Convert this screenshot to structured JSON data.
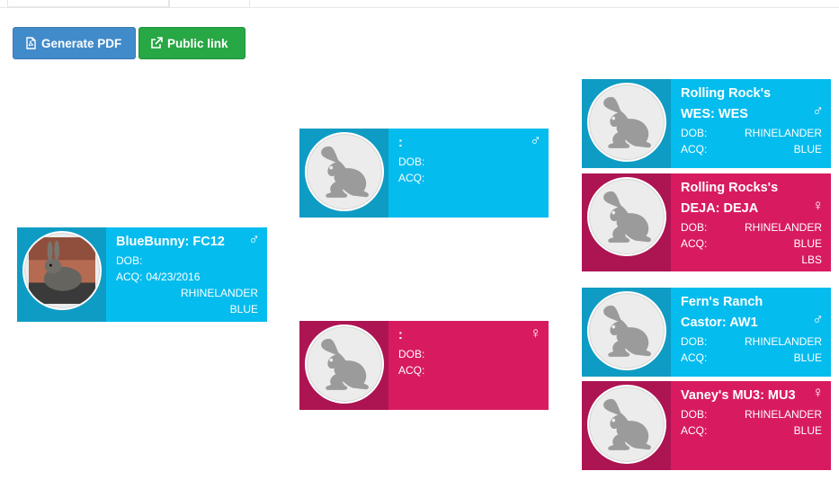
{
  "toolbar": {
    "generate_pdf_label": "Generate PDF",
    "public_link_label": "Public link"
  },
  "colors": {
    "male_card": "#04bcee",
    "female_card": "#d81b60",
    "pdf_button": "#428bca",
    "link_button": "#28a745"
  },
  "labels": {
    "dob": "DOB:",
    "acq": "ACQ:"
  },
  "subject": {
    "name": "BlueBunny: FC12",
    "sex_symbol": "♂",
    "dob": "",
    "acq": "04/23/2016",
    "breed": "RHINELANDER",
    "color": "BLUE",
    "photo": "rabbit-photo"
  },
  "sire": {
    "name": ":",
    "sex_symbol": "♂",
    "dob": "",
    "acq": "",
    "photo": "rabbit-silhouette-icon"
  },
  "dam": {
    "name": ":",
    "sex_symbol": "♀",
    "dob": "",
    "acq": "",
    "photo": "rabbit-silhouette-icon"
  },
  "sire_sire": {
    "name": "Rolling Rock's WES: WES",
    "sex_symbol": "♂",
    "breed": "RHINELANDER",
    "color": "BLUE"
  },
  "sire_dam": {
    "name": "Rolling Rocks's DEJA: DEJA",
    "sex_symbol": "♀",
    "breed": "RHINELANDER",
    "color": "BLUE",
    "weight": "LBS"
  },
  "dam_sire": {
    "name": "Fern's Ranch Castor: AW1",
    "sex_symbol": "♂",
    "breed": "RHINELANDER",
    "color": "BLUE"
  },
  "dam_dam": {
    "name": "Vaney's MU3: MU3",
    "sex_symbol": "♀",
    "breed": "RHINELANDER",
    "color": "BLUE"
  }
}
